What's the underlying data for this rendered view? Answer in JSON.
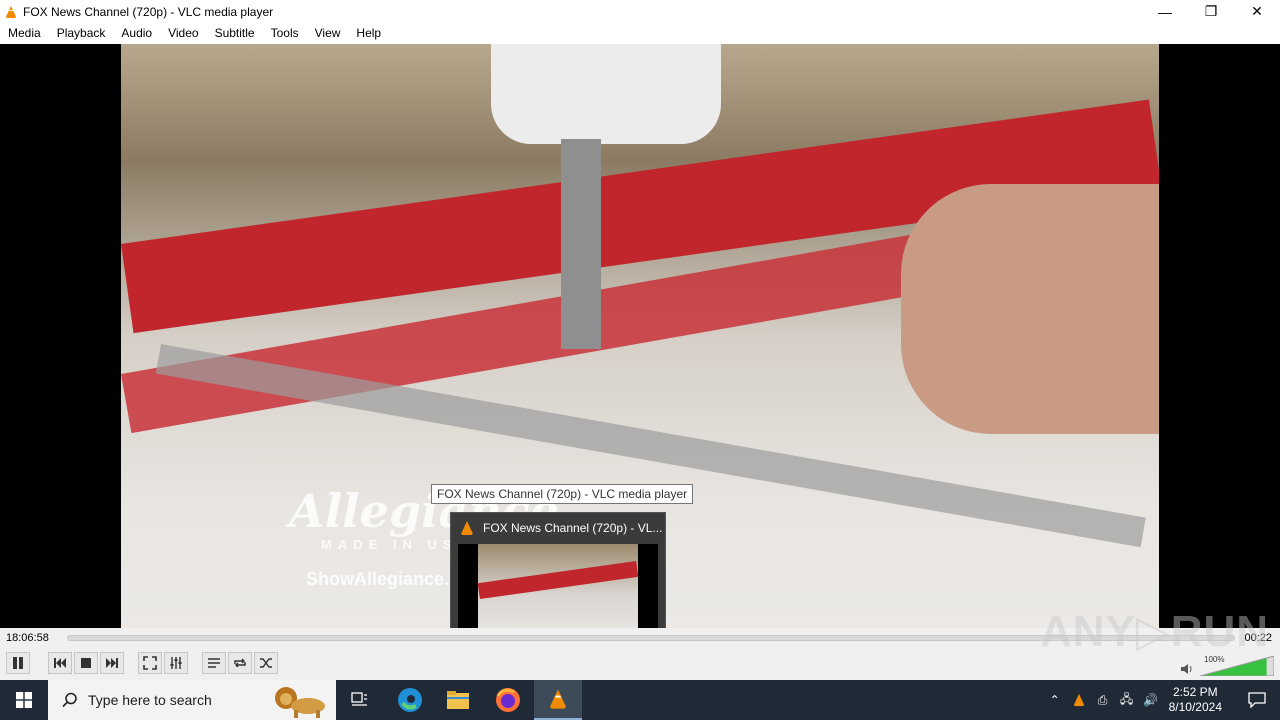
{
  "window": {
    "title": "FOX News Channel (720p) - VLC media player",
    "minimize": "—",
    "restore": "❐",
    "close": "✕"
  },
  "menu": [
    "Media",
    "Playback",
    "Audio",
    "Video",
    "Subtitle",
    "Tools",
    "View",
    "Help"
  ],
  "video": {
    "watermark_logo": "Allegiance",
    "watermark_sub": "MADE IN USA",
    "watermark_url": "ShowAllegiance.com"
  },
  "tooltip": "FOX News Channel (720p) - VLC media player",
  "thumbnail": {
    "title": "FOX News Channel (720p) - VL...",
    "pause_glyph": "❚❚"
  },
  "player": {
    "elapsed": "18:06:58",
    "remaining": "00:22",
    "volume": "100%",
    "volume_level": 1.0,
    "progress": 0.0
  },
  "overlay_brand": "ANY▷RUN",
  "taskbar": {
    "search_placeholder": "Type here to search",
    "time": "2:52 PM",
    "date": "8/10/2024"
  },
  "colors": {
    "vlc_orange": "#f08a00",
    "volume_green": "#36c23e",
    "taskbar": "#1f2a36"
  }
}
